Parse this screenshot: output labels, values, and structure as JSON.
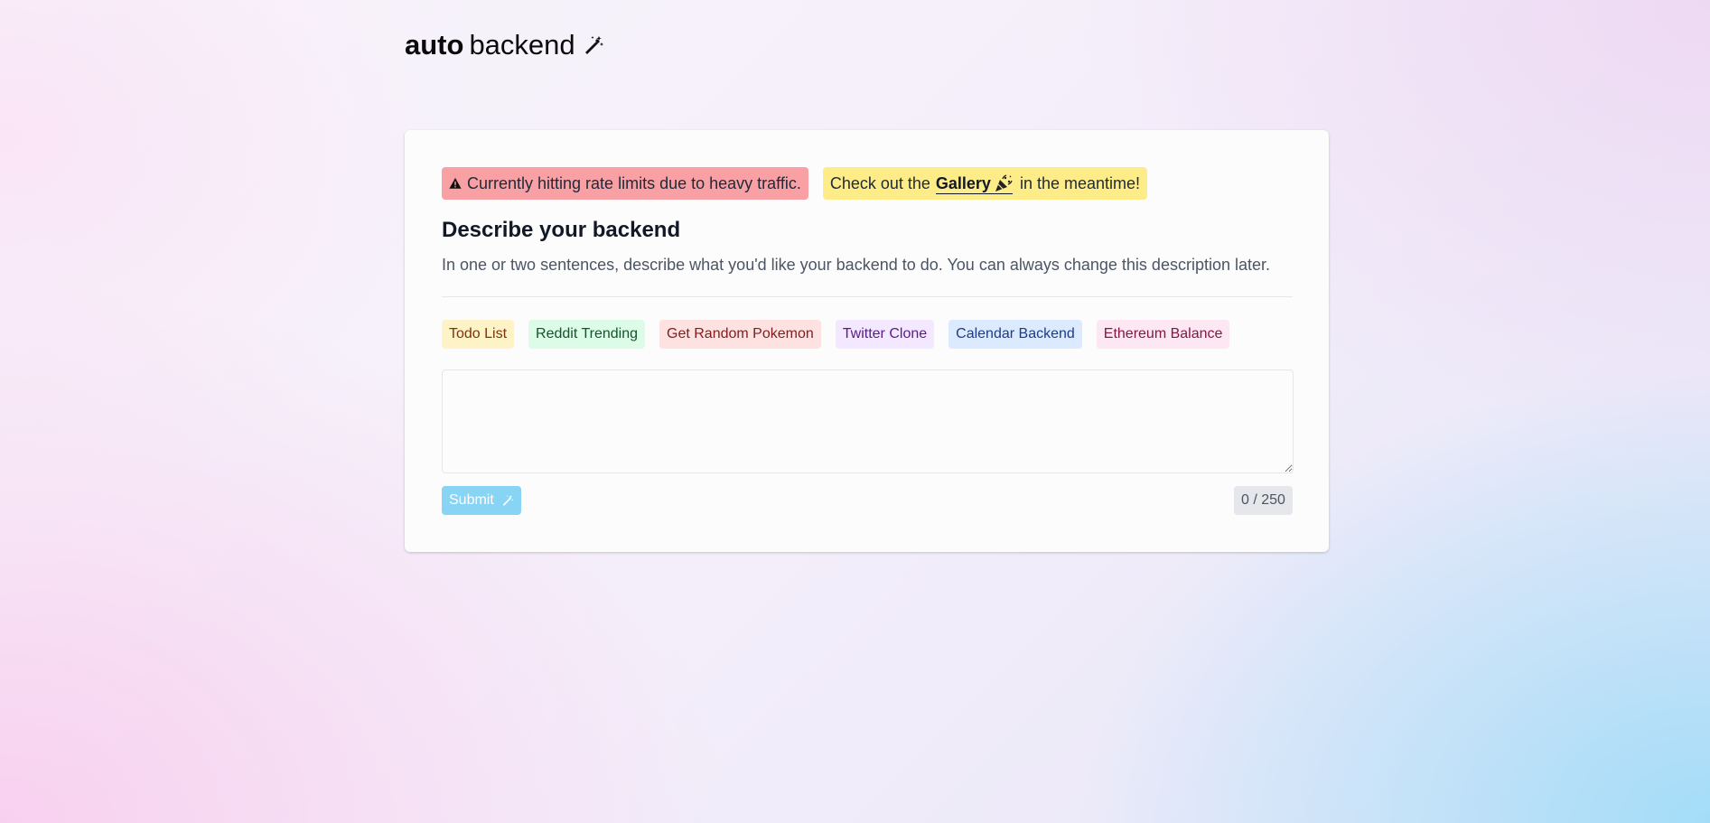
{
  "logo": {
    "bold": "auto",
    "normal": "backend",
    "icon": "magic-wand-icon"
  },
  "alerts": {
    "rate_limit": {
      "text": "Currently hitting rate limits due to heavy traffic.",
      "icon": "warning-icon",
      "color": "#f8a0a3"
    },
    "gallery": {
      "prefix": "Check out the",
      "link": "Gallery",
      "icon": "party-popper-icon",
      "suffix": "in the meantime!",
      "color": "#fdec88"
    }
  },
  "form": {
    "heading": "Describe your backend",
    "description": "In one or two sentences, describe what you'd like your backend to do. You can always change this description later.",
    "examples": [
      {
        "label": "Todo List",
        "color": "#fef3c7"
      },
      {
        "label": "Reddit Trending",
        "color": "#dcfce7"
      },
      {
        "label": "Get Random Pokemon",
        "color": "#fee2e2"
      },
      {
        "label": "Twitter Clone",
        "color": "#f3e8ff"
      },
      {
        "label": "Calendar Backend",
        "color": "#dbeafe"
      },
      {
        "label": "Ethereum Balance",
        "color": "#fce7f3"
      }
    ],
    "textarea_value": "",
    "submit_label": "Submit",
    "submit_icon": "magic-wand-icon",
    "submit_color": "#88d4f5",
    "char_count": "0 / 250"
  }
}
